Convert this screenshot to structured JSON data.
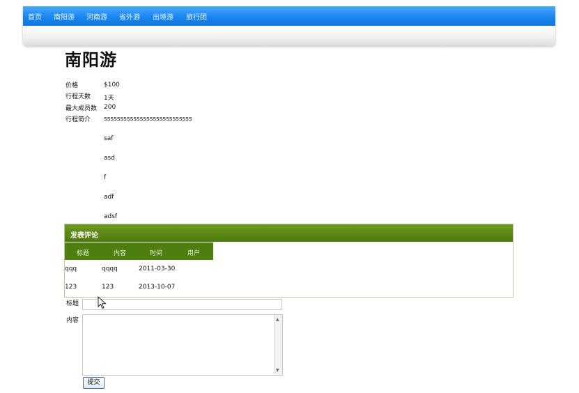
{
  "nav": {
    "items": [
      {
        "label": "首页"
      },
      {
        "label": "南阳游"
      },
      {
        "label": "河南游"
      },
      {
        "label": "省外游"
      },
      {
        "label": "出境游"
      },
      {
        "label": "旅行团"
      }
    ]
  },
  "page": {
    "title": "南阳游"
  },
  "info": {
    "price_label": "价格",
    "price_value": "$100",
    "days_label": "行程天数",
    "days_value": "1天",
    "members_label": "最大成员数",
    "members_value": "200",
    "intro_label": "行程简介",
    "intro_lines": [
      "sssssssssssssssssssssssssss",
      "saf",
      "asd",
      "f",
      "adf",
      "adsf"
    ]
  },
  "comments": {
    "header": "发表评论",
    "columns": [
      "标题",
      "内容",
      "时间",
      "用户"
    ],
    "rows": [
      [
        "qqq",
        "qqqq",
        "2011-03-30",
        ""
      ],
      [
        "123",
        "123",
        "2013-10-07",
        ""
      ]
    ]
  },
  "form": {
    "title_label": "标题",
    "content_label": "内容",
    "submit_label": "提交",
    "title_value": "",
    "content_value": ""
  },
  "colors": {
    "nav_blue": "#1a86f0",
    "panel_green": "#4d7a0d"
  }
}
